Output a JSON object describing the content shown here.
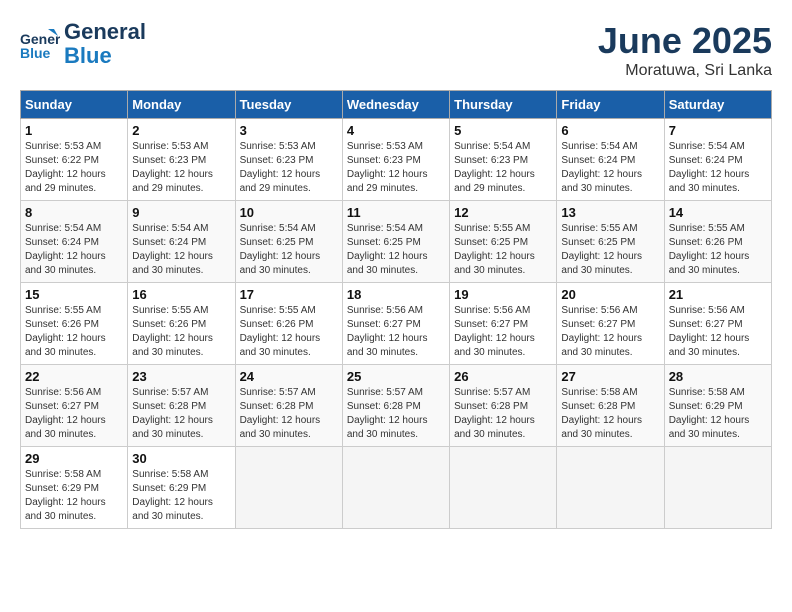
{
  "logo": {
    "line1": "General",
    "line2": "Blue"
  },
  "title": "June 2025",
  "location": "Moratuwa, Sri Lanka",
  "days_of_week": [
    "Sunday",
    "Monday",
    "Tuesday",
    "Wednesday",
    "Thursday",
    "Friday",
    "Saturday"
  ],
  "weeks": [
    [
      {
        "day": "1",
        "info": "Sunrise: 5:53 AM\nSunset: 6:22 PM\nDaylight: 12 hours\nand 29 minutes."
      },
      {
        "day": "2",
        "info": "Sunrise: 5:53 AM\nSunset: 6:23 PM\nDaylight: 12 hours\nand 29 minutes."
      },
      {
        "day": "3",
        "info": "Sunrise: 5:53 AM\nSunset: 6:23 PM\nDaylight: 12 hours\nand 29 minutes."
      },
      {
        "day": "4",
        "info": "Sunrise: 5:53 AM\nSunset: 6:23 PM\nDaylight: 12 hours\nand 29 minutes."
      },
      {
        "day": "5",
        "info": "Sunrise: 5:54 AM\nSunset: 6:23 PM\nDaylight: 12 hours\nand 29 minutes."
      },
      {
        "day": "6",
        "info": "Sunrise: 5:54 AM\nSunset: 6:24 PM\nDaylight: 12 hours\nand 30 minutes."
      },
      {
        "day": "7",
        "info": "Sunrise: 5:54 AM\nSunset: 6:24 PM\nDaylight: 12 hours\nand 30 minutes."
      }
    ],
    [
      {
        "day": "8",
        "info": "Sunrise: 5:54 AM\nSunset: 6:24 PM\nDaylight: 12 hours\nand 30 minutes."
      },
      {
        "day": "9",
        "info": "Sunrise: 5:54 AM\nSunset: 6:24 PM\nDaylight: 12 hours\nand 30 minutes."
      },
      {
        "day": "10",
        "info": "Sunrise: 5:54 AM\nSunset: 6:25 PM\nDaylight: 12 hours\nand 30 minutes."
      },
      {
        "day": "11",
        "info": "Sunrise: 5:54 AM\nSunset: 6:25 PM\nDaylight: 12 hours\nand 30 minutes."
      },
      {
        "day": "12",
        "info": "Sunrise: 5:55 AM\nSunset: 6:25 PM\nDaylight: 12 hours\nand 30 minutes."
      },
      {
        "day": "13",
        "info": "Sunrise: 5:55 AM\nSunset: 6:25 PM\nDaylight: 12 hours\nand 30 minutes."
      },
      {
        "day": "14",
        "info": "Sunrise: 5:55 AM\nSunset: 6:26 PM\nDaylight: 12 hours\nand 30 minutes."
      }
    ],
    [
      {
        "day": "15",
        "info": "Sunrise: 5:55 AM\nSunset: 6:26 PM\nDaylight: 12 hours\nand 30 minutes."
      },
      {
        "day": "16",
        "info": "Sunrise: 5:55 AM\nSunset: 6:26 PM\nDaylight: 12 hours\nand 30 minutes."
      },
      {
        "day": "17",
        "info": "Sunrise: 5:55 AM\nSunset: 6:26 PM\nDaylight: 12 hours\nand 30 minutes."
      },
      {
        "day": "18",
        "info": "Sunrise: 5:56 AM\nSunset: 6:27 PM\nDaylight: 12 hours\nand 30 minutes."
      },
      {
        "day": "19",
        "info": "Sunrise: 5:56 AM\nSunset: 6:27 PM\nDaylight: 12 hours\nand 30 minutes."
      },
      {
        "day": "20",
        "info": "Sunrise: 5:56 AM\nSunset: 6:27 PM\nDaylight: 12 hours\nand 30 minutes."
      },
      {
        "day": "21",
        "info": "Sunrise: 5:56 AM\nSunset: 6:27 PM\nDaylight: 12 hours\nand 30 minutes."
      }
    ],
    [
      {
        "day": "22",
        "info": "Sunrise: 5:56 AM\nSunset: 6:27 PM\nDaylight: 12 hours\nand 30 minutes."
      },
      {
        "day": "23",
        "info": "Sunrise: 5:57 AM\nSunset: 6:28 PM\nDaylight: 12 hours\nand 30 minutes."
      },
      {
        "day": "24",
        "info": "Sunrise: 5:57 AM\nSunset: 6:28 PM\nDaylight: 12 hours\nand 30 minutes."
      },
      {
        "day": "25",
        "info": "Sunrise: 5:57 AM\nSunset: 6:28 PM\nDaylight: 12 hours\nand 30 minutes."
      },
      {
        "day": "26",
        "info": "Sunrise: 5:57 AM\nSunset: 6:28 PM\nDaylight: 12 hours\nand 30 minutes."
      },
      {
        "day": "27",
        "info": "Sunrise: 5:58 AM\nSunset: 6:28 PM\nDaylight: 12 hours\nand 30 minutes."
      },
      {
        "day": "28",
        "info": "Sunrise: 5:58 AM\nSunset: 6:29 PM\nDaylight: 12 hours\nand 30 minutes."
      }
    ],
    [
      {
        "day": "29",
        "info": "Sunrise: 5:58 AM\nSunset: 6:29 PM\nDaylight: 12 hours\nand 30 minutes."
      },
      {
        "day": "30",
        "info": "Sunrise: 5:58 AM\nSunset: 6:29 PM\nDaylight: 12 hours\nand 30 minutes."
      },
      {
        "day": "",
        "info": ""
      },
      {
        "day": "",
        "info": ""
      },
      {
        "day": "",
        "info": ""
      },
      {
        "day": "",
        "info": ""
      },
      {
        "day": "",
        "info": ""
      }
    ]
  ]
}
